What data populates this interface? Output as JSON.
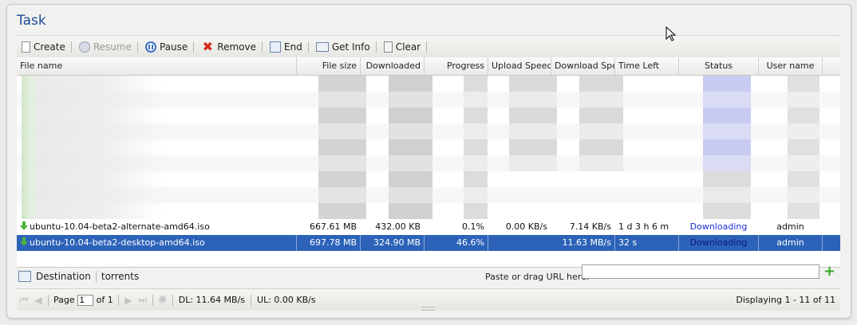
{
  "panel": {
    "title": "Task"
  },
  "toolbar": {
    "create": "Create",
    "resume": "Resume",
    "pause": "Pause",
    "remove": "Remove",
    "end": "End",
    "get_info": "Get Info",
    "clear": "Clear"
  },
  "grid": {
    "columns": [
      "File name",
      "File size",
      "Downloaded",
      "Progress",
      "Upload Speed",
      "Download Speed",
      "Time Left",
      "Status",
      "User name"
    ],
    "rows": [
      {
        "name": "ubuntu-10.04-beta2-alternate-amd64.iso",
        "size": "667.61 MB",
        "downloaded": "432.00 KB",
        "progress": "0.1%",
        "up": "0.00 KB/s",
        "down": "7.14 KB/s",
        "time_left": "1 d 3 h 6 m",
        "status": "Downloading",
        "user": "admin"
      },
      {
        "name": "ubuntu-10.04-beta2-desktop-amd64.iso",
        "size": "697.78 MB",
        "downloaded": "324.90 MB",
        "progress": "46.6%",
        "up": "",
        "down": "11.63 MB/s",
        "time_left": "32 s",
        "status": "Downloading",
        "user": "admin"
      }
    ]
  },
  "destination": {
    "label": "Destination",
    "value": "torrents",
    "url_label": "Paste or drag URL here:",
    "url_value": ""
  },
  "paging": {
    "page_label": "Page",
    "page_value": "1",
    "of_label": "of 1",
    "dl": "DL: 11.64 MB/s",
    "ul": "UL: 0.00 KB/s",
    "displaying": "Displaying 1 - 11 of 11"
  },
  "colors": {
    "accent": "#1a4c9e",
    "selection": "#2c63b9",
    "status_link": "#1b2bd4"
  }
}
